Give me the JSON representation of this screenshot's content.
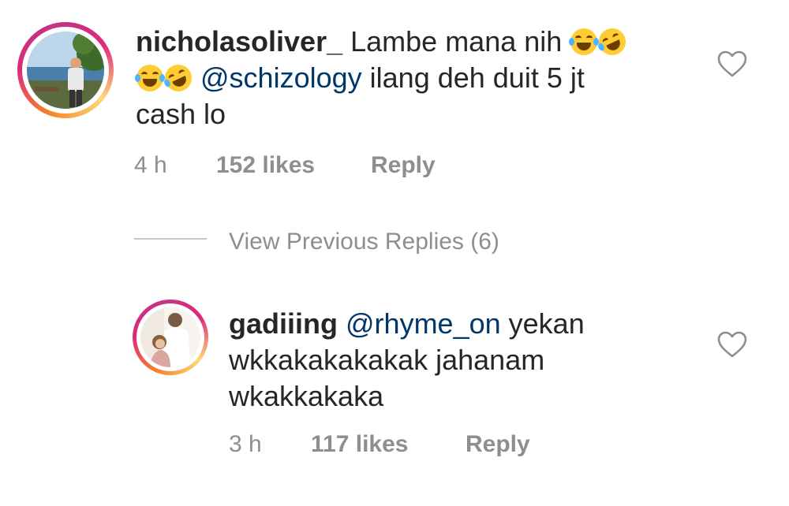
{
  "comments": [
    {
      "username": "nicholasoliver_",
      "text_part1": " Lambe mana nih ",
      "mention": "@schizology",
      "text_part2": " ilang deh duit 5 jt",
      "text_line3": "cash lo",
      "emoji_icons": [
        "face-with-tears-of-joy-icon",
        "rolling-on-the-floor-laughing-icon"
      ],
      "time": "4 h",
      "likes": "152 likes",
      "reply_label": "Reply"
    },
    {
      "username": "gadiiing",
      "mention": "@rhyme_on",
      "text_part1": " yekan",
      "text_line2": "wkkakakakakak jahanam",
      "text_line3": "wkakkakaka",
      "time": "3 h",
      "likes": "117 likes",
      "reply_label": "Reply"
    }
  ],
  "replies_toggle": {
    "label": "View Previous Replies (6)"
  },
  "colors": {
    "text": "#262626",
    "meta": "#8e8e8e",
    "mention": "#00376b",
    "divider": "#c7c7c7"
  }
}
